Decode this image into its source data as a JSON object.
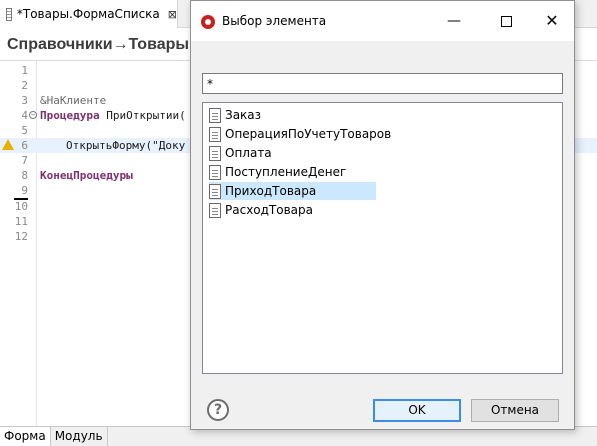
{
  "editor": {
    "tab_title": "*Товары.ФормаСписка",
    "tab_close": "⊠",
    "breadcrumb": "Справочники→Товары→",
    "lines": [
      {
        "num": "1"
      },
      {
        "num": "2"
      },
      {
        "num": "3",
        "text": "&НаКлиенте"
      },
      {
        "num": "4",
        "keyword": "Процедура",
        "text": "ПриОткрытии("
      },
      {
        "num": "5"
      },
      {
        "num": "6",
        "text": "ОткрытьФорму(\"Доку"
      },
      {
        "num": "7"
      },
      {
        "num": "8",
        "keyword": "КонецПроцедуры"
      },
      {
        "num": "9"
      },
      {
        "num": "10"
      },
      {
        "num": "11"
      },
      {
        "num": "12"
      }
    ],
    "bottom_tabs": [
      "Форма",
      "Модуль"
    ]
  },
  "dialog": {
    "title": "Выбор элемента",
    "minimize": "—",
    "close": "✕",
    "filter_value": "*",
    "items": [
      "Заказ",
      "ОперацияПоУчетуТоваров",
      "Оплата",
      "ПоступлениеДенег",
      "ПриходТовара",
      "РасходТовара"
    ],
    "selected_item": "ПриходТовара",
    "help": "?",
    "ok_label": "OK",
    "cancel_label": "Отмена"
  },
  "colors": {
    "keyword": "#7f2f6e",
    "selection": "#cce8ff",
    "ok_border": "#3b8ee6",
    "string": "#1a1ad0"
  }
}
